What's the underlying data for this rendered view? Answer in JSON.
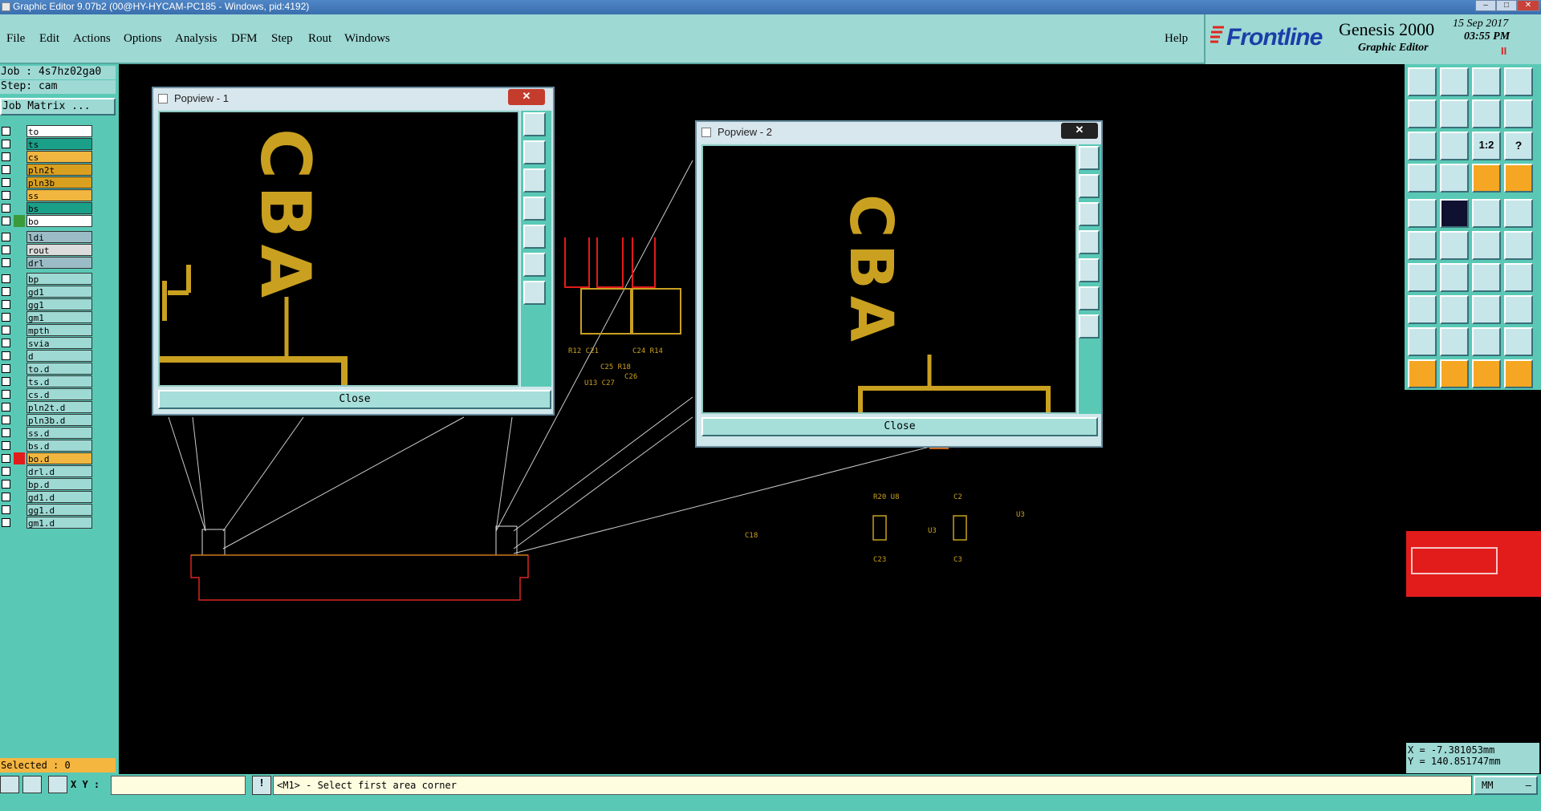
{
  "window": {
    "title": "Graphic Editor 9.07b2 (00@HY-HYCAM-PC185 - Windows, pid:4192)",
    "min_label": "–",
    "max_label": "□",
    "close_label": "✕"
  },
  "menu": {
    "items": [
      "File",
      "Edit",
      "Actions",
      "Options",
      "Analysis",
      "DFM",
      "Step",
      "Rout",
      "Windows"
    ],
    "help": "Help"
  },
  "brand": {
    "logo": "Frontline",
    "product": "Genesis 2000",
    "subtitle": "Graphic Editor",
    "date": "15 Sep 2017",
    "time": "03:55 PM",
    "pause": "II"
  },
  "job": {
    "job_line": "Job : 4s7hz02ga0",
    "step_line": "Step: cam",
    "matrix_button": "Job Matrix ..."
  },
  "layers": [
    {
      "name": "to",
      "color": "#ffffff",
      "swatch": ""
    },
    {
      "name": "ts",
      "color": "#1aa089",
      "swatch": ""
    },
    {
      "name": "cs",
      "color": "#f0b640",
      "swatch": ""
    },
    {
      "name": "pln2t",
      "color": "#d9a020",
      "swatch": ""
    },
    {
      "name": "pln3b",
      "color": "#d9a020",
      "swatch": ""
    },
    {
      "name": "ss",
      "color": "#f0b640",
      "swatch": ""
    },
    {
      "name": "bs",
      "color": "#1aa089",
      "swatch": ""
    },
    {
      "name": "bo",
      "color": "#ffffff",
      "swatch": "#3a9a3a"
    },
    {
      "name": "ldi",
      "color": "#9bbcc6",
      "swatch": ""
    },
    {
      "name": "rout",
      "color": "#dcdcdc",
      "swatch": ""
    },
    {
      "name": "drl",
      "color": "#9bbcc6",
      "swatch": ""
    },
    {
      "name": "bp",
      "color": "#9ed9d4",
      "swatch": ""
    },
    {
      "name": "gd1",
      "color": "#9ed9d4",
      "swatch": ""
    },
    {
      "name": "gg1",
      "color": "#9ed9d4",
      "swatch": ""
    },
    {
      "name": "gm1",
      "color": "#9ed9d4",
      "swatch": ""
    },
    {
      "name": "mpth",
      "color": "#9ed9d4",
      "swatch": ""
    },
    {
      "name": "svia",
      "color": "#9ed9d4",
      "swatch": ""
    },
    {
      "name": "d",
      "color": "#9ed9d4",
      "swatch": ""
    },
    {
      "name": "to.d",
      "color": "#9ed9d4",
      "swatch": ""
    },
    {
      "name": "ts.d",
      "color": "#9ed9d4",
      "swatch": ""
    },
    {
      "name": "cs.d",
      "color": "#9ed9d4",
      "swatch": ""
    },
    {
      "name": "pln2t.d",
      "color": "#9ed9d4",
      "swatch": ""
    },
    {
      "name": "pln3b.d",
      "color": "#9ed9d4",
      "swatch": ""
    },
    {
      "name": "ss.d",
      "color": "#9ed9d4",
      "swatch": ""
    },
    {
      "name": "bs.d",
      "color": "#9ed9d4",
      "swatch": ""
    },
    {
      "name": "bo.d",
      "color": "#f0b640",
      "swatch": "#e21b1b"
    },
    {
      "name": "drl.d",
      "color": "#9ed9d4",
      "swatch": ""
    },
    {
      "name": "bp.d",
      "color": "#9ed9d4",
      "swatch": ""
    },
    {
      "name": "gd1.d",
      "color": "#9ed9d4",
      "swatch": ""
    },
    {
      "name": "gg1.d",
      "color": "#9ed9d4",
      "swatch": ""
    },
    {
      "name": "gm1.d",
      "color": "#9ed9d4",
      "swatch": ""
    }
  ],
  "selected": "Selected : 0",
  "popview1": {
    "title": "Popview - 1",
    "close_label": "Close",
    "x_label": "✕",
    "text": "CBA"
  },
  "popview2": {
    "title": "Popview - 2",
    "close_label": "Close",
    "x_label": "✕",
    "text": "CBA"
  },
  "coords": {
    "x": "X  = -7.381053mm",
    "y": "Y  = 140.851747mm"
  },
  "bottom": {
    "xy_label": "X Y :",
    "xy_value": "",
    "prompt": "<M1> - Select first area corner",
    "units": "MM",
    "units_arrow": "–",
    "info_icon": "!"
  },
  "toolbar": {
    "one_to_two": "1:2",
    "help_q": "?"
  },
  "colors": {
    "accent": "#59c9b6",
    "gold": "#c9a020",
    "red": "#e21b1b"
  }
}
